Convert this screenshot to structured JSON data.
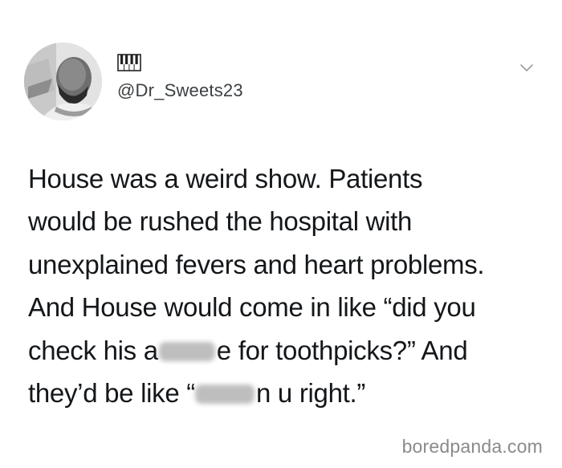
{
  "tweet": {
    "handle": "@Dr_Sweets23",
    "lines": [
      "House was a weird show. Patients",
      "would be rushed the hospital with",
      "unexplained fevers and heart problems.",
      "And House would come in like “did you"
    ],
    "line5_before": "check his a",
    "line5_after": "e for toothpicks?” And",
    "line6_before": "they’d be like “",
    "line6_after": "n u right.”"
  },
  "icons": {
    "piano": "piano-keys-icon",
    "menu": "chevron-down-icon"
  },
  "watermark": "boredpanda.com"
}
